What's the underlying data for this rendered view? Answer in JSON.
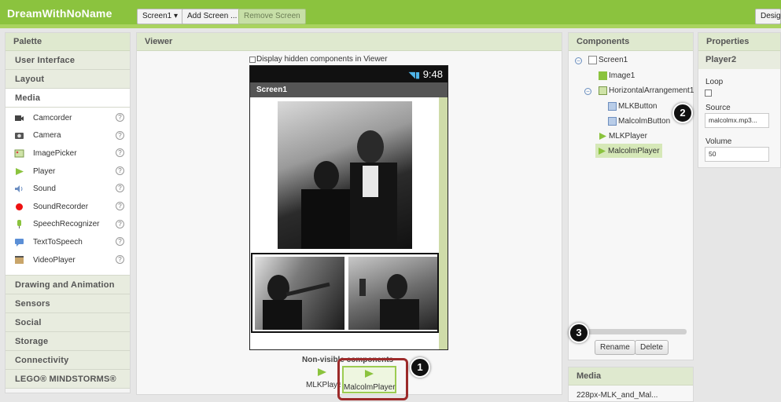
{
  "topbar": {
    "app_title": "DreamWithNoName",
    "screen_selector": "Screen1 ▾",
    "add_screen": "Add Screen ...",
    "remove_screen": "Remove Screen",
    "designer": "Designer"
  },
  "palette": {
    "title": "Palette",
    "categories_top": [
      "User Interface",
      "Layout",
      "Media"
    ],
    "media_items": [
      {
        "label": "Camcorder",
        "icon": "camcorder-icon"
      },
      {
        "label": "Camera",
        "icon": "camera-icon"
      },
      {
        "label": "ImagePicker",
        "icon": "imagepicker-icon"
      },
      {
        "label": "Player",
        "icon": "player-icon"
      },
      {
        "label": "Sound",
        "icon": "sound-icon"
      },
      {
        "label": "SoundRecorder",
        "icon": "soundrecorder-icon"
      },
      {
        "label": "SpeechRecognizer",
        "icon": "speechrecognizer-icon"
      },
      {
        "label": "TextToSpeech",
        "icon": "texttospeech-icon"
      },
      {
        "label": "VideoPlayer",
        "icon": "videoplayer-icon"
      }
    ],
    "help_glyph": "?",
    "categories_bottom": [
      "Drawing and Animation",
      "Sensors",
      "Social",
      "Storage",
      "Connectivity",
      "LEGO® MINDSTORMS®"
    ]
  },
  "viewer": {
    "title": "Viewer",
    "hidden_checkbox_label": "Display hidden components in Viewer",
    "status_time": "9:48",
    "screen_title": "Screen1",
    "nonvisible_label": "Non-visible components",
    "nonvisible_items": [
      "MLKPlayer",
      "MalcolmPlayer"
    ]
  },
  "components": {
    "title": "Components",
    "tree": [
      "Screen1",
      "Image1",
      "HorizontalArrangement1",
      "MLKButton",
      "MalcolmButton",
      "MLKPlayer",
      "MalcolmPlayer"
    ],
    "rename": "Rename",
    "delete": "Delete"
  },
  "media": {
    "title": "Media",
    "items": [
      "228px-MLK_and_Mal..."
    ]
  },
  "properties": {
    "title": "Properties",
    "component": "Player2",
    "loop_label": "Loop",
    "source_label": "Source",
    "source_value": "malcolmx.mp3...",
    "volume_label": "Volume",
    "volume_value": "50"
  },
  "callouts": [
    "1",
    "2",
    "3"
  ],
  "colors": {
    "accent": "#8bc33e",
    "selected": "#d6e8b8",
    "callout_ring": "#9c2a2a"
  }
}
